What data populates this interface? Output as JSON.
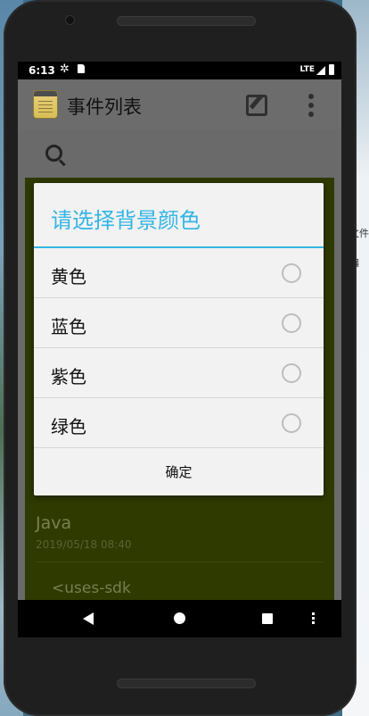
{
  "status_bar": {
    "time": "6:13",
    "network": "LTE"
  },
  "action_bar": {
    "title": "事件列表"
  },
  "list": [
    {
      "title": "Java",
      "date": "2019/05/18 08:40"
    },
    {
      "title": "<uses-sdk"
    }
  ],
  "dialog": {
    "title": "请选择背景颜色",
    "options": [
      {
        "label": "黄色"
      },
      {
        "label": "蓝色"
      },
      {
        "label": "紫色"
      },
      {
        "label": "绿色"
      }
    ],
    "confirm_label": "确定"
  },
  "desktop": {
    "right_fragment_1": "文件",
    "right_fragment_2": "编"
  },
  "colors": {
    "accent": "#33b5e5",
    "list_background": "#2f3a00"
  }
}
